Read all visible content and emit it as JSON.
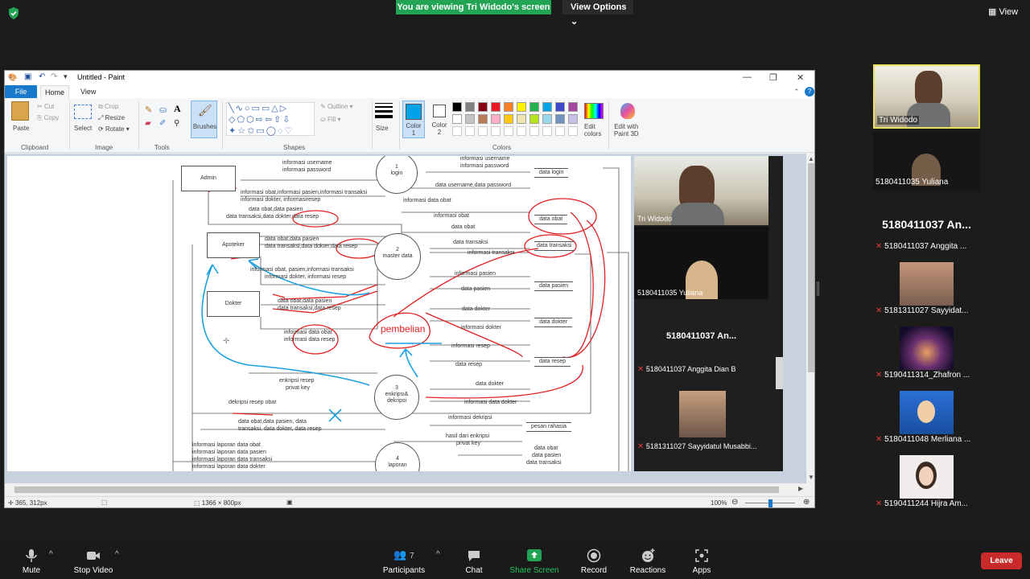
{
  "banner": {
    "viewing": "You are viewing Tri Widodo's screen",
    "view_options": "View Options",
    "view": "View"
  },
  "paint": {
    "title": "Untitled - Paint",
    "tabs": {
      "file": "File",
      "home": "Home",
      "view": "View"
    },
    "clipboard": {
      "paste": "Paste",
      "cut": "Cut",
      "copy": "Copy",
      "group": "Clipboard"
    },
    "image": {
      "select": "Select",
      "crop": "Crop",
      "resize": "Resize",
      "rotate": "Rotate",
      "group": "Image"
    },
    "tools": {
      "group": "Tools"
    },
    "brushes": {
      "label": "Brushes"
    },
    "shapes": {
      "outline": "Outline",
      "fill": "Fill",
      "group": "Shapes"
    },
    "size": {
      "label": "Size"
    },
    "colors": {
      "color1": "Color\n1",
      "color2": "Color\n2",
      "edit": "Edit\ncolors",
      "paint3d": "Edit with\nPaint 3D",
      "group": "Colors"
    },
    "palette": [
      "#000000",
      "#7f7f7f",
      "#880015",
      "#ed1c24",
      "#ff7f27",
      "#fff200",
      "#22b14c",
      "#00a2e8",
      "#3f48cc",
      "#a349a4",
      "#ffffff",
      "#c3c3c3",
      "#b97a57",
      "#ffaec9",
      "#ffc90e",
      "#efe4b0",
      "#b5e61d",
      "#99d9ea",
      "#7092be",
      "#c8bfe7"
    ],
    "status": {
      "pos": "365, 312px",
      "size": "1366 × 800px",
      "zoom": "100%"
    }
  },
  "dfd": {
    "admin": "Admin",
    "apoteker": "Apoteker",
    "dokter": "Dokter",
    "p1_num": "1",
    "p1": "login",
    "p2_num": "2",
    "p2": "master data",
    "p3_num": "3",
    "p3": "enkripsi& dekripsi",
    "p4_num": "4",
    "p4": "laporan",
    "ds_login": "data login",
    "ds_obat": "data obat",
    "ds_transaksi": "data transaksi",
    "ds_pasien": "data pasien",
    "ds_dokter": "data dokter",
    "ds_resep": "data resep",
    "ds_pesan": "pesan rahasia",
    "f1": "informasi username",
    "f2": "informasi password",
    "f3": "informasi username",
    "f4": "informasi password",
    "f5": "data username,data password",
    "f6": "informasi obat,informasi pasien,informasi transaksi",
    "f7": "informasi dokter, informasiresep",
    "f8": "data obat,data pasien",
    "f9": "data transaksi,data dokter,data resep",
    "f10": "informasi data obat",
    "f11": "informasi obat",
    "f12": "data obat",
    "f13": "data obat,data pasien",
    "f14": "data transaksi,data dokter,data resep",
    "f15": "data transaksi",
    "f16": "informasi transaksi",
    "f17": "informasi obat, pasien,informasi transaksi",
    "f18": "informasi dokter, informasi resep",
    "f19": "informasi pasien",
    "f20": "data pasien",
    "f21": "data obat,data pasien",
    "f22": "data transaksi,data resep",
    "f23": "data dokter",
    "f24": "informasi dokter",
    "f25": "informasi data obat",
    "f26": "informasi data resep",
    "f27": "informasi resep",
    "f28": "data resep",
    "f29": "enkripsi resep",
    "f30": "privat key",
    "f31": "data dokter",
    "f32": "informasi data dokter",
    "f33": "dekripsi resep obat",
    "f34": "data obat,data pasien, data",
    "f35": "transaksi, data dokter, data resep",
    "f36": "informasi dekripsi",
    "f37": "hasil dari enkripsi",
    "f38": "privat key",
    "f39": "informasi laporan data obat",
    "f40": "informasi laporan data pasien",
    "f41": "informasi laporan data transaksi",
    "f42": "informasi laporan data dokter",
    "f43": "data obat",
    "f44": "data pasien",
    "f45": "data transaksi",
    "annotation": "pembelian"
  },
  "overlay": {
    "name1": "Tri Widodo",
    "name2": "5180411035 Yuliana",
    "big_name": "5180411037  An...",
    "name3": "5180411037 Anggita Dian B",
    "name4": "5181311027 Sayyidatul Musabbi..."
  },
  "participants": [
    {
      "name": "Tri Widodo",
      "muted": false
    },
    {
      "name": "5180411035 Yuliana",
      "muted": false
    },
    {
      "name": "5180411037 Anggita ...",
      "muted": true,
      "big": "5180411037  An..."
    },
    {
      "name": "5181311027 Sayyidat...",
      "muted": true
    },
    {
      "name": "5190411314_Zhafron ...",
      "muted": true
    },
    {
      "name": "5180411048 Merliana ...",
      "muted": true
    },
    {
      "name": "5190411244 Hijra Am...",
      "muted": true
    }
  ],
  "toolbar": {
    "mute": "Mute",
    "stop_video": "Stop Video",
    "participants": "Participants",
    "participant_count": "7",
    "chat": "Chat",
    "share": "Share Screen",
    "record": "Record",
    "reactions": "Reactions",
    "apps": "Apps",
    "leave": "Leave"
  },
  "colors": {
    "green": "#23a455",
    "blue": "#1979ca",
    "red": "#c92b2b",
    "selected_tile_border": "#e8e35b"
  }
}
